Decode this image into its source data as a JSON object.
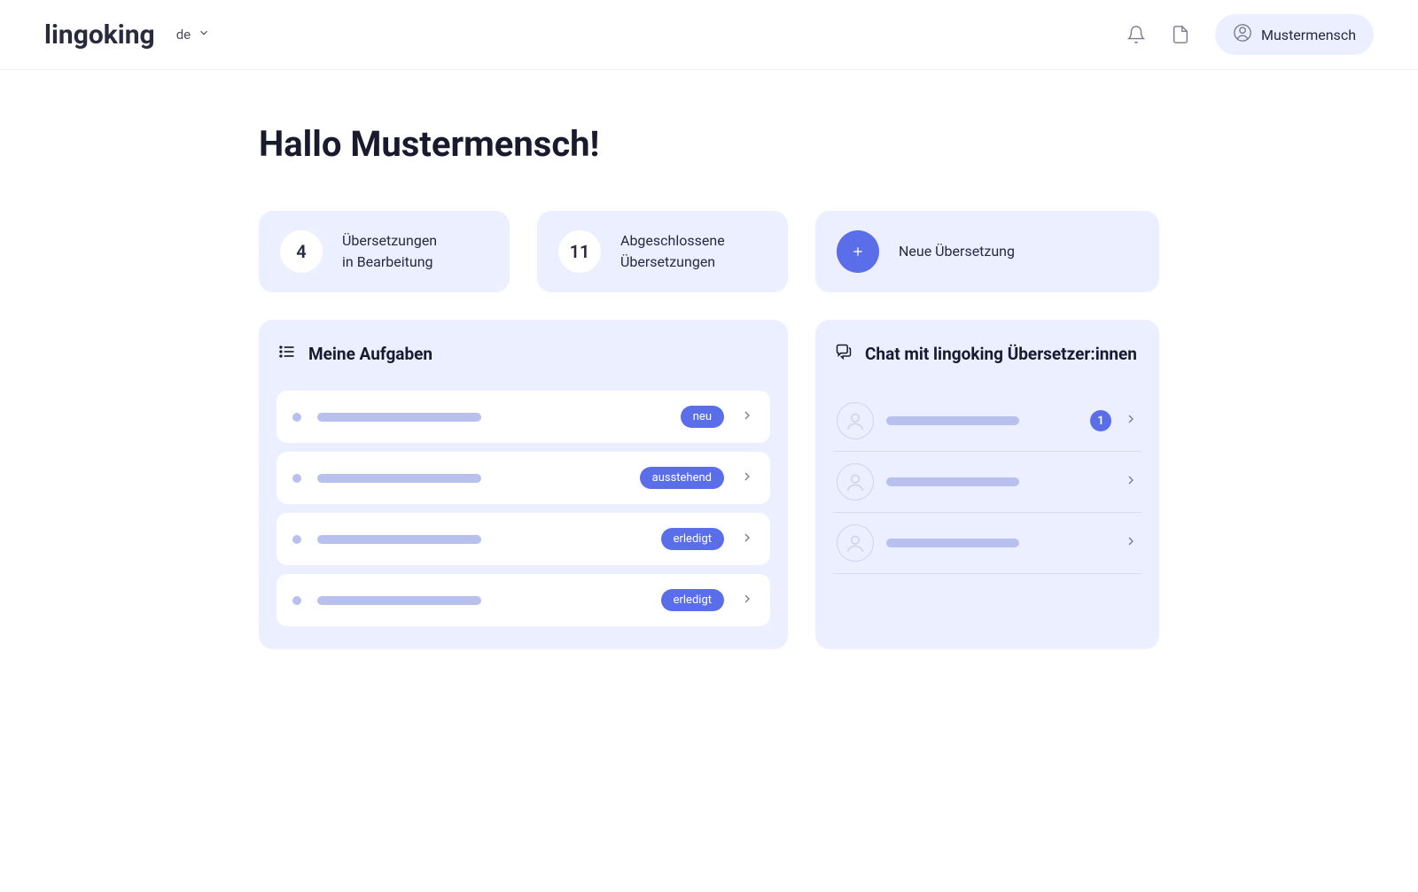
{
  "header": {
    "logo": "lingoking",
    "language": "de",
    "username": "Mustermensch"
  },
  "greeting": "Hallo Mustermensch!",
  "stats": [
    {
      "value": "4",
      "label": "Übersetzungen\nin Bearbeitung"
    },
    {
      "value": "11",
      "label": "Abgeschlossene\nÜbersetzungen"
    },
    {
      "action": true,
      "label": "Neue Übersetzung"
    }
  ],
  "tasks": {
    "title": "Meine Aufgaben",
    "items": [
      {
        "status": "neu"
      },
      {
        "status": "ausstehend"
      },
      {
        "status": "erledigt"
      },
      {
        "status": "erledigt"
      }
    ]
  },
  "chat": {
    "title": "Chat mit lingoking Übersetzer:innen",
    "items": [
      {
        "unread": "1"
      },
      {
        "unread": null
      },
      {
        "unread": null
      }
    ]
  }
}
